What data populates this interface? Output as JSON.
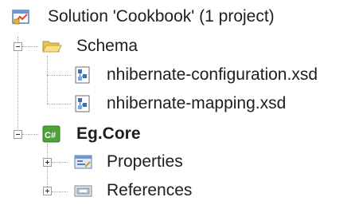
{
  "tree": {
    "solution": {
      "label": "Solution 'Cookbook' (1 project)",
      "icon": "solution-icon"
    },
    "schema_folder": {
      "label": "Schema",
      "icon": "folder-open-icon",
      "expanded": true,
      "children": [
        {
          "label": "nhibernate-configuration.xsd",
          "icon": "xsd-file-icon"
        },
        {
          "label": "nhibernate-mapping.xsd",
          "icon": "xsd-file-icon"
        }
      ]
    },
    "project": {
      "label": "Eg.Core",
      "icon": "csharp-project-icon",
      "expanded": true,
      "children": [
        {
          "label": "Properties",
          "icon": "properties-icon",
          "expanded": false
        },
        {
          "label": "References",
          "icon": "references-icon",
          "expanded": false
        }
      ]
    }
  },
  "colors": {
    "text": "#1e1e1e",
    "tree_lines": "#a8a8a8",
    "folder": "#f2d26a",
    "csharp_green": "#4ea23c",
    "file_blue": "#3c6fb4"
  }
}
